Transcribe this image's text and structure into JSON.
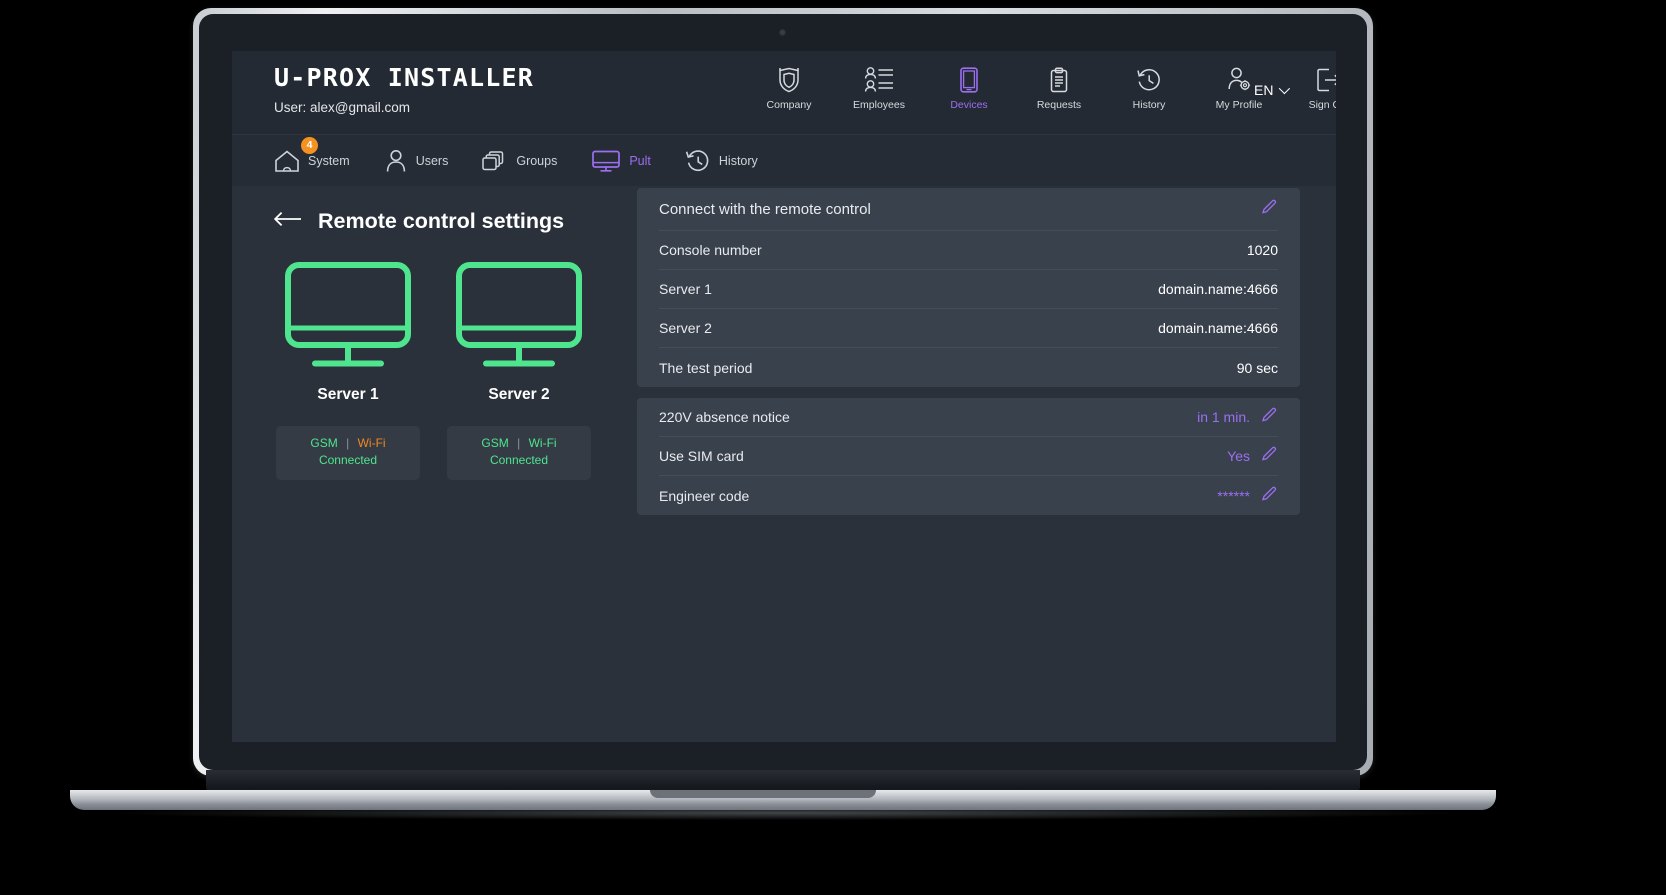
{
  "header": {
    "logo": "U-PROX INSTALLER",
    "user_label": "User: alex@gmail.com",
    "language": "EN",
    "nav": [
      {
        "label": "Company",
        "icon": "shield-icon",
        "active": false
      },
      {
        "label": "Employees",
        "icon": "employees-icon",
        "active": false
      },
      {
        "label": "Devices",
        "icon": "device-tablet-icon",
        "active": true
      },
      {
        "label": "Requests",
        "icon": "clipboard-icon",
        "active": false
      },
      {
        "label": "History",
        "icon": "clock-icon",
        "active": false
      },
      {
        "label": "My Profile",
        "icon": "user-gear-icon",
        "active": false
      },
      {
        "label": "Sign Out",
        "icon": "sign-out-icon",
        "active": false
      }
    ]
  },
  "subnav": [
    {
      "label": "System",
      "icon": "home-icon",
      "badge": "4",
      "active": false
    },
    {
      "label": "Users",
      "icon": "user-icon",
      "badge": "",
      "active": false
    },
    {
      "label": "Groups",
      "icon": "groups-icon",
      "badge": "",
      "active": false
    },
    {
      "label": "Pult",
      "icon": "monitor-icon",
      "badge": "",
      "active": true
    },
    {
      "label": "History",
      "icon": "history-icon",
      "badge": "",
      "active": false
    }
  ],
  "page": {
    "title": "Remote control settings",
    "back_icon": "arrow-left-icon"
  },
  "servers": [
    {
      "name": "Server 1",
      "icon": "monitor-icon",
      "channels": [
        {
          "label": "GSM",
          "color": "#4fe48e"
        },
        {
          "label": "Wi-Fi",
          "color": "#f08a1e"
        }
      ],
      "separator": "|",
      "status": "Connected",
      "status_color": "#4fe48e"
    },
    {
      "name": "Server 2",
      "icon": "monitor-icon",
      "channels": [
        {
          "label": "GSM",
          "color": "#4fe48e"
        },
        {
          "label": "Wi-Fi",
          "color": "#4fe48e"
        }
      ],
      "separator": "|",
      "status": "Connected",
      "status_color": "#4fe48e"
    }
  ],
  "settings": {
    "group_1": {
      "title": "Connect with the remote control",
      "title_edit_icon": "pencil-icon",
      "rows": [
        {
          "key": "Console number",
          "value": "1020",
          "accent": false,
          "editable": false
        },
        {
          "key": "Server 1",
          "value": "domain.name:4666",
          "accent": false,
          "editable": false
        },
        {
          "key": "Server 2",
          "value": "domain.name:4666",
          "accent": false,
          "editable": false
        },
        {
          "key": "The test period",
          "value": "90 sec",
          "accent": false,
          "editable": false
        }
      ]
    },
    "group_2": {
      "rows": [
        {
          "key": "220V absence notice",
          "value": "in 1 min.",
          "accent": true,
          "editable": true
        },
        {
          "key": "Use SIM card",
          "value": "Yes",
          "accent": true,
          "editable": true
        },
        {
          "key": "Engineer code",
          "value": "******",
          "accent": true,
          "editable": true
        }
      ]
    }
  },
  "colors": {
    "accent_purple": "#9b6ff0",
    "accent_green": "#4fe48e",
    "accent_orange": "#f08a1e",
    "badge_orange": "#f39220",
    "screen_bg": "#2b313a",
    "panel_bg": "#39414d",
    "header_bg": "#242a33"
  }
}
